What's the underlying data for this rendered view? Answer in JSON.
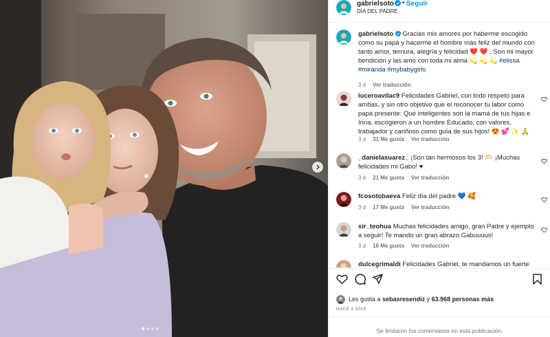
{
  "post": {
    "username": "gabrielsoto",
    "follow_label": "Seguir",
    "separator": "•",
    "subtitle": "DIA DEL PADRE",
    "colors": {
      "link": "#0095f6",
      "hashtag": "#00376b",
      "muted": "#737373",
      "text": "#262626"
    }
  },
  "caption": {
    "username": "gabrielsoto",
    "text": "Gracias mis amores por haberme escogido como su papá y hacerme el hombre más feliz del mundo con tanto amor, ternura, alegría y felicidad ❤️ ❤️ . Son mi mayor bendición y las amo con toda mi alma 💫 💫 💫",
    "hashtags": [
      "#elissa",
      "#miranda",
      "#mybabygirls"
    ],
    "age": "3 d",
    "translate_label": "Ver traducción"
  },
  "comments": [
    {
      "username": "luceroavilac9",
      "text": "Felicidades Gabriel, con todo respeto para ambas, y sin otro objetivo que el reconocer tu labor como papá presente: Qué inteligentes son la mamá de tus hijas e Irina, escogieron a un hombre Educado, con valores, trabajador y cariñoso como guía de sus hijos! 😍 💕 ✨ 🙏",
      "age": "3 d",
      "likes": "31 Me gusta",
      "translate_label": "Ver traducción"
    },
    {
      "username": "_danielasuarez_",
      "text": "¡Son tan hermosos los 3! 🫶🏻 ¡Muchas felicidades mi Gabo! ♥",
      "age": "3 d",
      "likes": "21 Me gusta",
      "translate_label": "Ver traducción"
    },
    {
      "username": "fcosotobaeva",
      "text": "Feliz día del padre 💙 🥰",
      "age": "3 d",
      "likes": "17 Me gusta",
      "translate_label": "Ver traducción"
    },
    {
      "username": "sir_teohua",
      "text": "Muchas felicidades amigo, gran Padre y ejemplo a seguir! Te mando un gran abrazo Gabuuuus!",
      "age": "3 d",
      "likes": "16 Me gusta",
      "translate_label": "Ver traducción"
    },
    {
      "username": "dulcegrimaldi",
      "text": "Felicidades Gabriel, te mandamos un fuerte",
      "age": "",
      "likes": "",
      "translate_label": ""
    }
  ],
  "likes": {
    "prefix": "Les gusta a",
    "user": "sebasresendiz",
    "connector": "y",
    "count": "63.968 personas más"
  },
  "timestamp": "HACE 3 DÍAS",
  "comments_limited": "Se limitaron los comentarios en esta publicación.",
  "icons": {
    "verified": "verified-badge-icon",
    "like": "heart-icon",
    "comment": "comment-icon",
    "share": "share-icon",
    "save": "bookmark-icon",
    "next": "chevron-right-icon"
  },
  "carousel": {
    "total": 4,
    "active": 1
  }
}
